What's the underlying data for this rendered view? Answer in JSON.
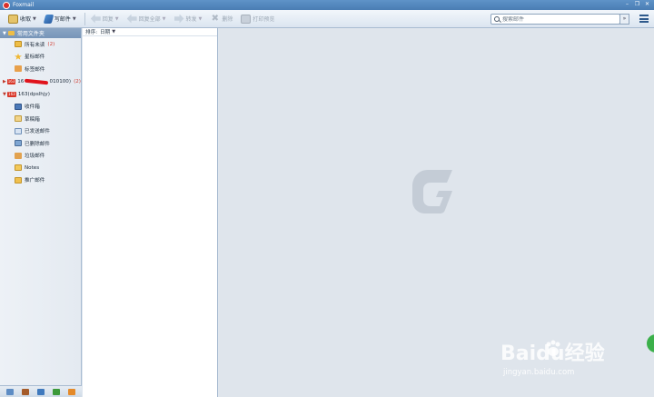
{
  "window": {
    "title": "Foxmail"
  },
  "toolbar": {
    "receive": "收取",
    "compose": "写邮件",
    "reply": "回复",
    "reply_all": "回复全部",
    "forward": "转发",
    "delete": "删除",
    "print": "打印预览"
  },
  "search": {
    "placeholder": "搜索邮件"
  },
  "sidebar": {
    "common_header": "常用文件夹",
    "common_items": [
      {
        "label": "所有未读",
        "count": "(2)"
      },
      {
        "label": "星标邮件"
      },
      {
        "label": "标签邮件"
      }
    ],
    "account1": {
      "label_prefix": "16",
      "label_suffix": "010100)",
      "count": "(2)"
    },
    "account2": {
      "label": "163(dpslhjy)"
    },
    "account2_items": [
      {
        "label": "收件箱"
      },
      {
        "label": "草稿箱"
      },
      {
        "label": "已发送邮件"
      },
      {
        "label": "已删除邮件"
      },
      {
        "label": "垃圾邮件"
      },
      {
        "label": "Notes"
      },
      {
        "label": "推广邮件"
      }
    ]
  },
  "maillist": {
    "sort_label": "排序:",
    "sort_value": "日期"
  },
  "watermark": {
    "brand": "Baidu经验",
    "url": "jingyan.baidu.com"
  },
  "colors": {
    "accent": "#4a7db3",
    "unread": "#d13b2f",
    "brand_red": "#d93628"
  }
}
